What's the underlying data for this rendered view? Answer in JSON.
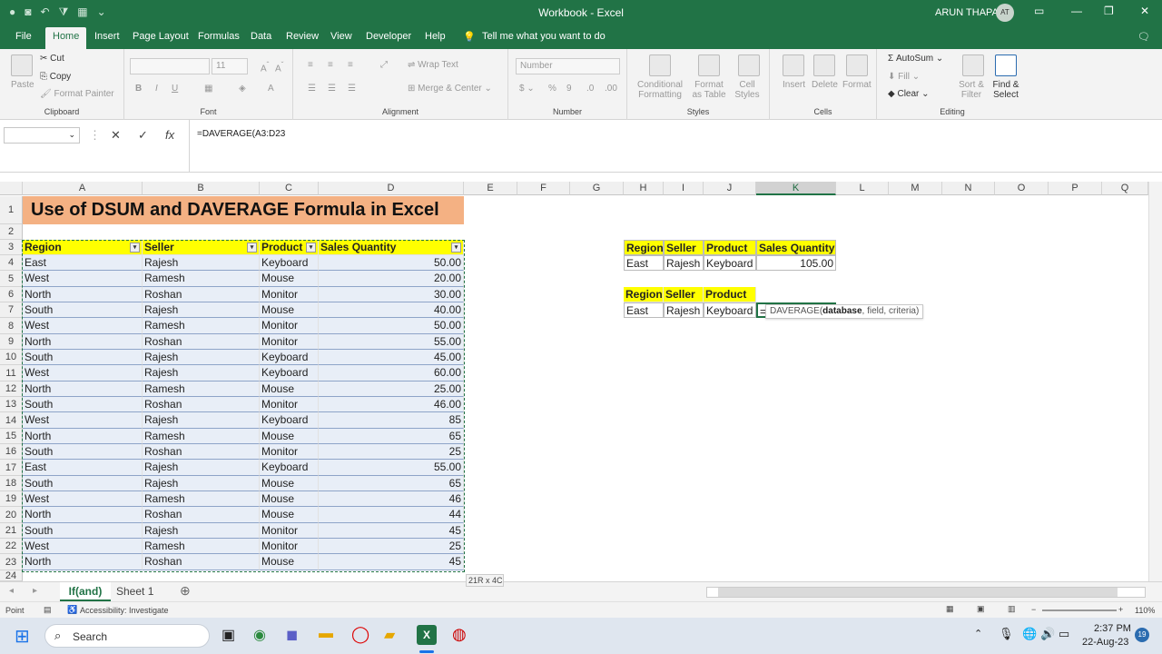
{
  "window": {
    "title": "Workbook  -  Excel",
    "user": "ARUN THAPA",
    "initials": "AT"
  },
  "menu": {
    "tabs": [
      "File",
      "Home",
      "Insert",
      "Page Layout",
      "Formulas",
      "Data",
      "Review",
      "View",
      "Developer",
      "Help"
    ],
    "tell_me": "Tell me what you want to do"
  },
  "ribbon": {
    "clipboard": {
      "paste": "Paste",
      "cut": "Cut",
      "copy": "Copy",
      "format_painter": "Format Painter",
      "label": "Clipboard"
    },
    "font": {
      "size": "11",
      "label": "Font"
    },
    "alignment": {
      "wrap": "Wrap Text",
      "merge": "Merge & Center",
      "label": "Alignment"
    },
    "number": {
      "format": "Number",
      "label": "Number"
    },
    "styles": {
      "conditional": "Conditional Formatting",
      "format_table": "Format as Table",
      "cell_styles": "Cell Styles",
      "label": "Styles"
    },
    "cells": {
      "insert": "Insert",
      "delete": "Delete",
      "format": "Format",
      "label": "Cells"
    },
    "editing": {
      "autosum": "AutoSum",
      "fill": "Fill",
      "clear": "Clear",
      "sort": "Sort & Filter",
      "find": "Find & Select",
      "label": "Editing"
    }
  },
  "formula_bar": {
    "formula": "=DAVERAGE(A3:D23"
  },
  "columns": [
    "A",
    "B",
    "C",
    "D",
    "E",
    "F",
    "G",
    "H",
    "I",
    "J",
    "K",
    "L",
    "M",
    "N",
    "O",
    "P",
    "Q"
  ],
  "rows": [
    "1",
    "2",
    "3",
    "4",
    "5",
    "6",
    "7",
    "8",
    "9",
    "10",
    "11",
    "12",
    "13",
    "14",
    "15",
    "16",
    "17",
    "18",
    "19",
    "20",
    "21",
    "22",
    "23",
    "24"
  ],
  "sheet": {
    "title": "Use of DSUM and DAVERAGE Formula in Excel",
    "headers": [
      "Region",
      "Seller",
      "Product",
      "Sales Quantity"
    ],
    "data": [
      [
        "East",
        "Rajesh",
        "Keyboard",
        "50.00"
      ],
      [
        "West",
        "Ramesh",
        "Mouse",
        "20.00"
      ],
      [
        "North",
        "Roshan",
        "Monitor",
        "30.00"
      ],
      [
        "South",
        "Rajesh",
        "Mouse",
        "40.00"
      ],
      [
        "West",
        "Ramesh",
        "Monitor",
        "50.00"
      ],
      [
        "North",
        "Roshan",
        "Monitor",
        "55.00"
      ],
      [
        "South",
        "Rajesh",
        "Keyboard",
        "45.00"
      ],
      [
        "West",
        "Rajesh",
        "Keyboard",
        "60.00"
      ],
      [
        "North",
        "Ramesh",
        "Mouse",
        "25.00"
      ],
      [
        "South",
        "Roshan",
        "Monitor",
        "46.00"
      ],
      [
        "West",
        "Rajesh",
        "Keyboard",
        "85"
      ],
      [
        "North",
        "Ramesh",
        "Mouse",
        "65"
      ],
      [
        "South",
        "Roshan",
        "Monitor",
        "25"
      ],
      [
        "East",
        "Rajesh",
        "Keyboard",
        "55.00"
      ],
      [
        "South",
        "Rajesh",
        "Mouse",
        "65"
      ],
      [
        "West",
        "Ramesh",
        "Mouse",
        "46"
      ],
      [
        "North",
        "Roshan",
        "Mouse",
        "44"
      ],
      [
        "South",
        "Rajesh",
        "Monitor",
        "45"
      ],
      [
        "West",
        "Ramesh",
        "Monitor",
        "25"
      ],
      [
        "North",
        "Roshan",
        "Mouse",
        "45"
      ]
    ],
    "criteria1": {
      "headers": [
        "Region",
        "Seller",
        "Product",
        "Sales Quantity"
      ],
      "values": [
        "East",
        "Rajesh",
        "Keyboard",
        "105.00"
      ]
    },
    "criteria2": {
      "headers": [
        "Region",
        "Seller",
        "Product"
      ],
      "values": [
        "East",
        "Rajesh",
        "Keyboard"
      ],
      "entry": "="
    },
    "tooltip_fn": "DAVERAGE(",
    "tooltip_bold": "database",
    "tooltip_rest": ", field, criteria)",
    "selection_size": "21R x 4C"
  },
  "sheets": {
    "tabs": [
      "If(and)",
      "Sheet 1"
    ]
  },
  "status": {
    "mode": "Point",
    "accessibility": "Accessibility: Investigate",
    "zoom": "110%"
  },
  "taskbar": {
    "search": "Search",
    "time": "2:37 PM",
    "date": "22-Aug-23",
    "notifications": "19"
  }
}
